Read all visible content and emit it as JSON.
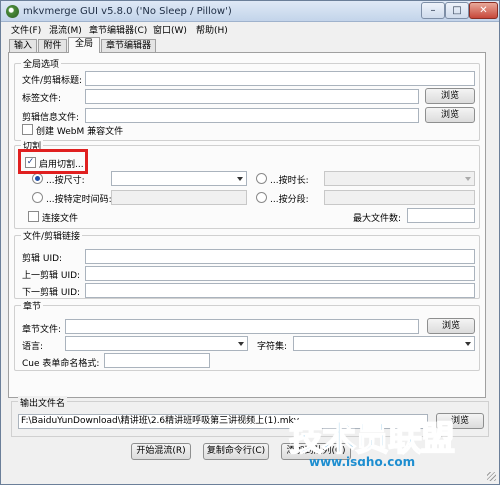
{
  "window": {
    "title": "mkvmerge GUI v5.8.0 ('No Sleep / Pillow')",
    "min_glyph": "–",
    "max_glyph": "□",
    "close_glyph": "✕"
  },
  "menu": [
    "文件(F)",
    "混流(M)",
    "章节编辑器(C)",
    "窗口(W)",
    "帮助(H)"
  ],
  "tabs": [
    {
      "label": "输入",
      "active": false
    },
    {
      "label": "附件",
      "active": false
    },
    {
      "label": "全局",
      "active": true
    },
    {
      "label": "章节编辑器",
      "active": false
    }
  ],
  "global_options": {
    "title": "全局选项",
    "file_title_label": "文件/剪辑标题:",
    "file_title_value": "",
    "tags_file_label": "标签文件:",
    "tags_file_value": "",
    "browse_label": "浏览",
    "segment_info_label": "剪辑信息文件:",
    "segment_info_value": "",
    "webm_label": "创建 WebM 兼容文件",
    "webm_checked": false
  },
  "split": {
    "title": "切割",
    "enable_label": "启用切割...",
    "enable_checked": true,
    "by_size_label": "...按尺寸:",
    "by_size_value": "",
    "by_duration_label": "...按时长:",
    "by_duration_value": "",
    "by_timecodes_label": "...按特定时间码:",
    "by_timecodes_value": "",
    "by_parts_label": "...按分段:",
    "by_parts_value": "",
    "link_files_label": "连接文件",
    "link_files_checked": false,
    "max_files_label": "最大文件数:",
    "max_files_value": ""
  },
  "linking": {
    "title": "文件/剪辑链接",
    "segment_uid_label": "剪辑 UID:",
    "prev_uid_label": "上一剪辑 UID:",
    "next_uid_label": "下一剪辑 UID:"
  },
  "chapters": {
    "title": "章节",
    "file_label": "章节文件:",
    "file_value": "",
    "browse_label": "浏览",
    "language_label": "语言:",
    "language_value": "",
    "charset_label": "字符集:",
    "charset_value": "",
    "cue_label": "Cue 表单命名格式:",
    "cue_value": ""
  },
  "output": {
    "title": "输出文件名",
    "value": "F:\\BaiduYunDownload\\精讲班\\2.6精讲班呼吸第三讲视频上(1).mkv",
    "browse_label": "浏览"
  },
  "actions": {
    "start_label": "开始混流(R)",
    "copy_label": "复制命令行(C)",
    "add_label": "添加到队列(Q)"
  },
  "watermark": {
    "brand": "技术员联盟",
    "url": "www.jsgho.com"
  }
}
